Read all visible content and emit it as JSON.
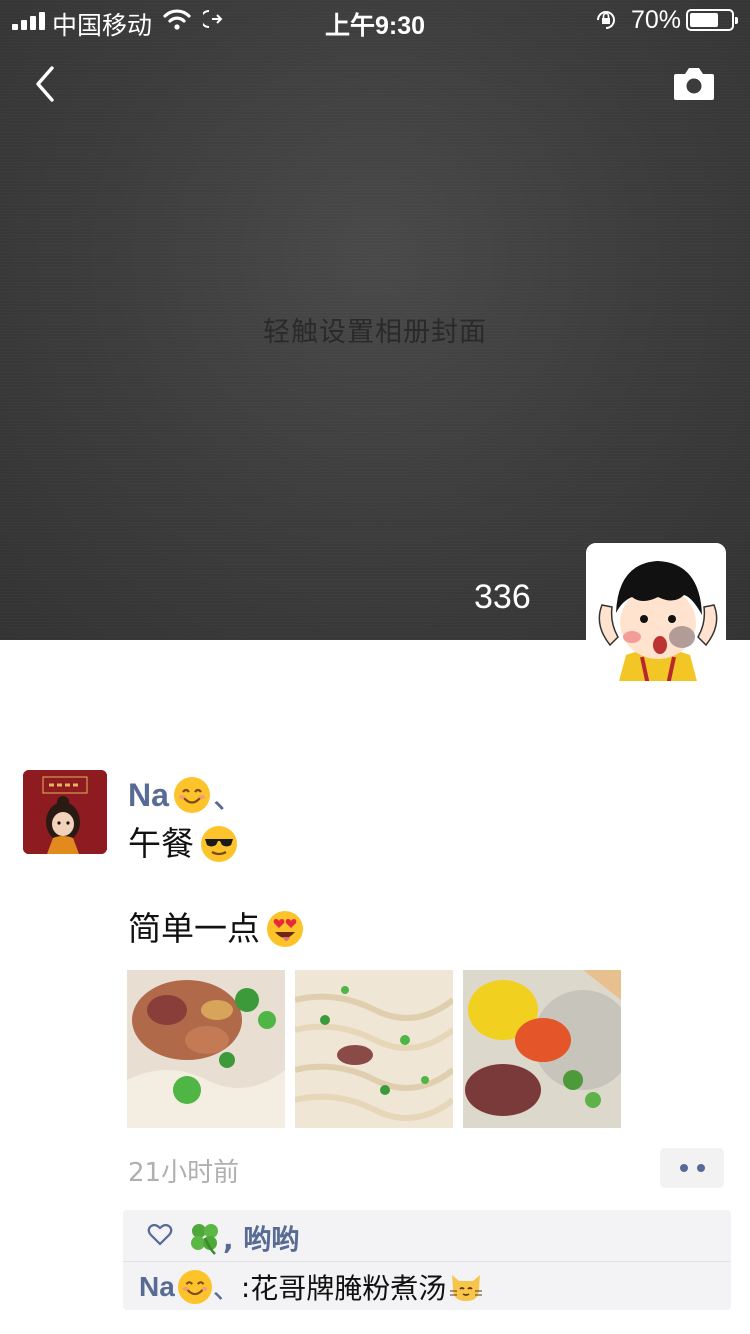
{
  "status_bar": {
    "carrier": "中国移动",
    "time": "上午9:30",
    "battery_percent": "70%",
    "battery_level": 0.7,
    "icons": [
      "signal-icon",
      "wifi-icon",
      "location-arrow-icon",
      "orientation-lock-icon",
      "battery-icon"
    ]
  },
  "nav": {
    "back_icon": "chevron-left-icon",
    "camera_icon": "camera-icon"
  },
  "cover": {
    "hint": "轻触设置相册封面",
    "count": "336"
  },
  "post": {
    "author": "Na",
    "author_suffix": "、",
    "lines": [
      "午餐",
      "简单一点"
    ],
    "timestamp": "21小时前",
    "photos": [
      "photo-noodles-bacon",
      "photo-noodles-scallion",
      "photo-soup-tomato"
    ],
    "likes": "🍀, 哟哟",
    "likers_text": "哟哟",
    "comment": {
      "author": "Na",
      "author_suffix": "、",
      "separator": ":",
      "text": "花哥牌腌粉煮汤"
    }
  },
  "colors": {
    "link": "#576b95",
    "cover_bg": "#3c3c3c",
    "comment_bg": "#f3f3f5",
    "timestamp": "#b0b0b0"
  }
}
